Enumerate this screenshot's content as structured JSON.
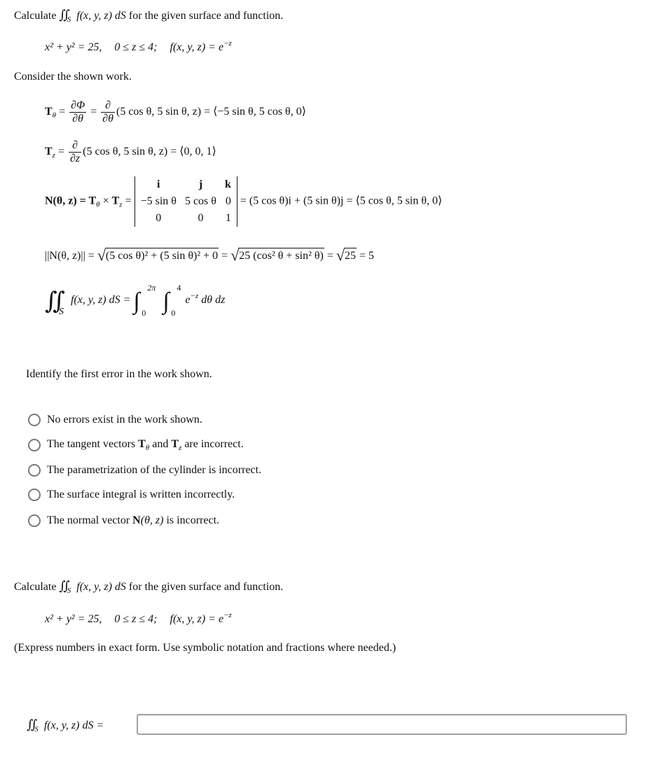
{
  "problem1": {
    "intro_prefix": "Calculate",
    "intro_integral_symbol": "∬",
    "intro_integral_sub": "S",
    "intro_integrand": "f(x, y, z) dS",
    "intro_suffix": "for the given surface and function.",
    "surface_eq": "x² + y² = 25,",
    "z_bounds": "0 ≤ z ≤ 4;",
    "function_eq": "f(x, y, z) = e",
    "function_exp": "−z",
    "consider_text": "Consider the shown work."
  },
  "work": {
    "t_theta": {
      "lhs": "T",
      "lhs_sub": "θ",
      "frac1_num": "∂Φ",
      "frac1_den": "∂θ",
      "frac2_num": "∂",
      "frac2_den": "∂θ",
      "param": "(5 cos θ, 5 sin θ, z) = ⟨−5 sin θ, 5 cos θ, 0⟩"
    },
    "t_z": {
      "lhs": "T",
      "lhs_sub": "z",
      "frac_num": "∂",
      "frac_den": "∂z",
      "param": "(5 cos θ, 5 sin θ, z) = ⟨0, 0, 1⟩"
    },
    "normal": {
      "lhs": "N(θ, z) = ",
      "cross": "T",
      "cross_sub1": "θ",
      "times": " × ",
      "cross_sub2": "z",
      "matrix": [
        [
          "i",
          "j",
          "k"
        ],
        [
          "−5 sin θ",
          "5 cos θ",
          "0"
        ],
        [
          "0",
          "0",
          "1"
        ]
      ],
      "result": "= (5 cos θ)i + (5 sin θ)j = ⟨5 cos θ, 5 sin θ, 0⟩"
    },
    "norm": {
      "lhs": "||N(θ, z)|| =",
      "rad1": "(5 cos θ)² + (5 sin θ)² + 0",
      "eq1": "=",
      "rad2": "25 (cos² θ + sin² θ)",
      "eq2": "=",
      "rad3": "25",
      "result": "= 5"
    },
    "integral": {
      "lhs": "f(x, y, z) dS =",
      "outer_upper": "2π",
      "outer_lower": "0",
      "inner_upper": "4",
      "inner_lower": "0",
      "integrand": "e",
      "integrand_exp": "−z",
      "differentials": "dθ dz"
    }
  },
  "question": {
    "prompt": "Identify the first error in the work shown.",
    "options": [
      {
        "label": "No errors exist in the work shown.",
        "selected": false
      },
      {
        "label_pre": "The tangent vectors ",
        "t1": "T",
        "t1_sub": "θ",
        "mid": " and ",
        "t2": "T",
        "t2_sub": "z",
        "label_post": " are incorrect.",
        "selected": false
      },
      {
        "label": "The parametrization of the cylinder is incorrect.",
        "selected": false
      },
      {
        "label": "The surface integral is written incorrectly.",
        "selected": false
      },
      {
        "label_pre": "The normal vector ",
        "bold": "N",
        "label_post_math": "(θ, z)",
        "label_post": " is incorrect.",
        "selected": false
      }
    ]
  },
  "problem2": {
    "intro_prefix": "Calculate",
    "intro_integral_symbol": "∬",
    "intro_integral_sub": "S",
    "intro_integrand": "f(x, y, z) dS",
    "intro_suffix": "for the given surface and function.",
    "surface_eq": "x² + y² = 25,",
    "z_bounds": "0 ≤ z ≤ 4;",
    "function_eq": "f(x, y, z) = e",
    "function_exp": "−z",
    "instructions": "(Express numbers in exact form. Use symbolic notation and fractions where needed.)",
    "answer_label": "f(x, y, z) dS =",
    "answer_value": "",
    "answer_placeholder": ""
  }
}
